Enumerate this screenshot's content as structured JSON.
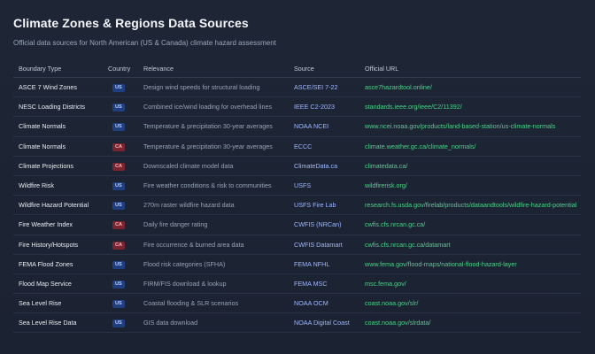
{
  "header": {
    "title": "Climate Zones & Regions Data Sources",
    "subtitle": "Official data sources for North American (US & Canada) climate hazard assessment"
  },
  "table": {
    "columns": [
      "Boundary Type",
      "Country",
      "Relevance",
      "Source",
      "Official URL"
    ],
    "rows": [
      {
        "type": "ASCE 7 Wind Zones",
        "country": "US",
        "relevance": "Design wind speeds for structural loading",
        "source": "ASCE/SEI 7-22",
        "url": "asce7hazardtool.online/"
      },
      {
        "type": "NESC Loading Districts",
        "country": "US",
        "relevance": "Combined ice/wind loading for overhead lines",
        "source": "IEEE C2-2023",
        "url": "standards.ieee.org/ieee/C2/11392/"
      },
      {
        "type": "Climate Normals",
        "country": "US",
        "relevance": "Temperature & precipitation 30-year averages",
        "source": "NOAA NCEI",
        "url": "www.ncei.noaa.gov/products/land-based-station/us-climate-normals"
      },
      {
        "type": "Climate Normals",
        "country": "CA",
        "relevance": "Temperature & precipitation 30-year averages",
        "source": "ECCC",
        "url": "climate.weather.gc.ca/climate_normals/"
      },
      {
        "type": "Climate Projections",
        "country": "CA",
        "relevance": "Downscaled climate model data",
        "source": "ClimateData.ca",
        "url": "climatedata.ca/"
      },
      {
        "type": "Wildfire Risk",
        "country": "US",
        "relevance": "Fire weather conditions & risk to communities",
        "source": "USFS",
        "url": "wildfirerisk.org/"
      },
      {
        "type": "Wildfire Hazard Potential",
        "country": "US",
        "relevance": "270m raster wildfire hazard data",
        "source": "USFS Fire Lab",
        "url": "research.fs.usda.gov/firelab/products/dataandtools/wildfire-hazard-potential"
      },
      {
        "type": "Fire Weather Index",
        "country": "CA",
        "relevance": "Daily fire danger rating",
        "source": "CWFIS (NRCan)",
        "url": "cwfis.cfs.nrcan.gc.ca/"
      },
      {
        "type": "Fire History/Hotspots",
        "country": "CA",
        "relevance": "Fire occurrence & burned area data",
        "source": "CWFIS Datamart",
        "url": "cwfis.cfs.nrcan.gc.ca/datamart"
      },
      {
        "type": "FEMA Flood Zones",
        "country": "US",
        "relevance": "Flood risk categories (SFHA)",
        "source": "FEMA NFHL",
        "url": "www.fema.gov/flood-maps/national-flood-hazard-layer"
      },
      {
        "type": "Flood Map Service",
        "country": "US",
        "relevance": "FIRM/FIS download & lookup",
        "source": "FEMA MSC",
        "url": "msc.fema.gov/"
      },
      {
        "type": "Sea Level Rise",
        "country": "US",
        "relevance": "Coastal flooding & SLR scenarios",
        "source": "NOAA OCM",
        "url": "coast.noaa.gov/slr/"
      },
      {
        "type": "Sea Level Rise Data",
        "country": "US",
        "relevance": "GIS data download",
        "source": "NOAA Digital Coast",
        "url": "coast.noaa.gov/slrdata/"
      }
    ]
  },
  "colors": {
    "background": "#1a2130",
    "source_link": "#9fb7ff",
    "url_link": "#4fd08a",
    "badge_us": "#1f3f80",
    "badge_ca": "#7a2430"
  }
}
